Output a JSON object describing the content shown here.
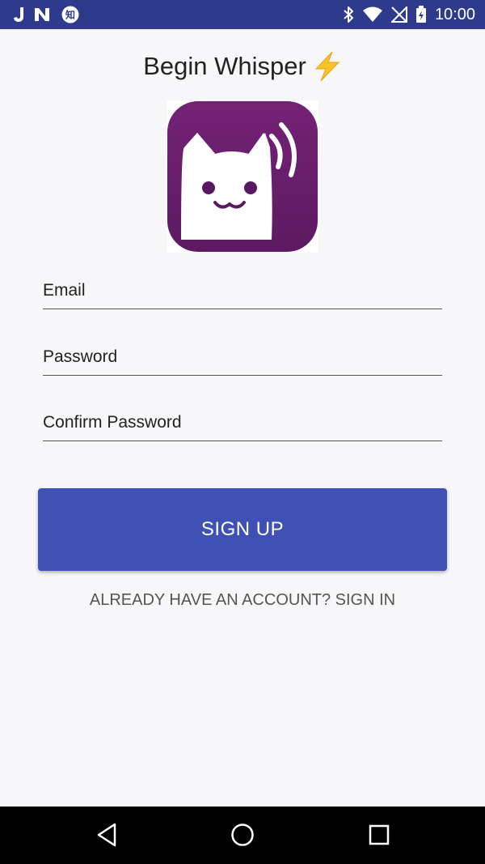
{
  "status_bar": {
    "time": "10:00",
    "left_icons": [
      "j-app-icon",
      "n-app-icon",
      "zhi-app-icon"
    ],
    "zhi_glyph": "知",
    "right_icons": [
      "bluetooth-icon",
      "wifi-icon",
      "no-signal-icon",
      "battery-icon"
    ]
  },
  "header": {
    "title": "Begin Whisper",
    "emoji_icon": "lightning-bolt-icon"
  },
  "logo": {
    "icon": "whisper-cat-logo",
    "colors": {
      "bg": "#6a1f6e",
      "face": "#ffffff",
      "features": "#5a1860"
    }
  },
  "form": {
    "email_placeholder": "Email",
    "password_placeholder": "Password",
    "confirm_password_placeholder": "Confirm Password",
    "submit_label": "SIGN UP",
    "signin_link": "ALREADY HAVE AN ACCOUNT? SIGN IN"
  },
  "nav_bar": {
    "buttons": [
      "back-icon",
      "home-icon",
      "recents-icon"
    ]
  },
  "colors": {
    "status_bar": "#2e3a8c",
    "primary": "#3f51b5",
    "background": "#f7f6f8",
    "nav_bar": "#000000"
  }
}
